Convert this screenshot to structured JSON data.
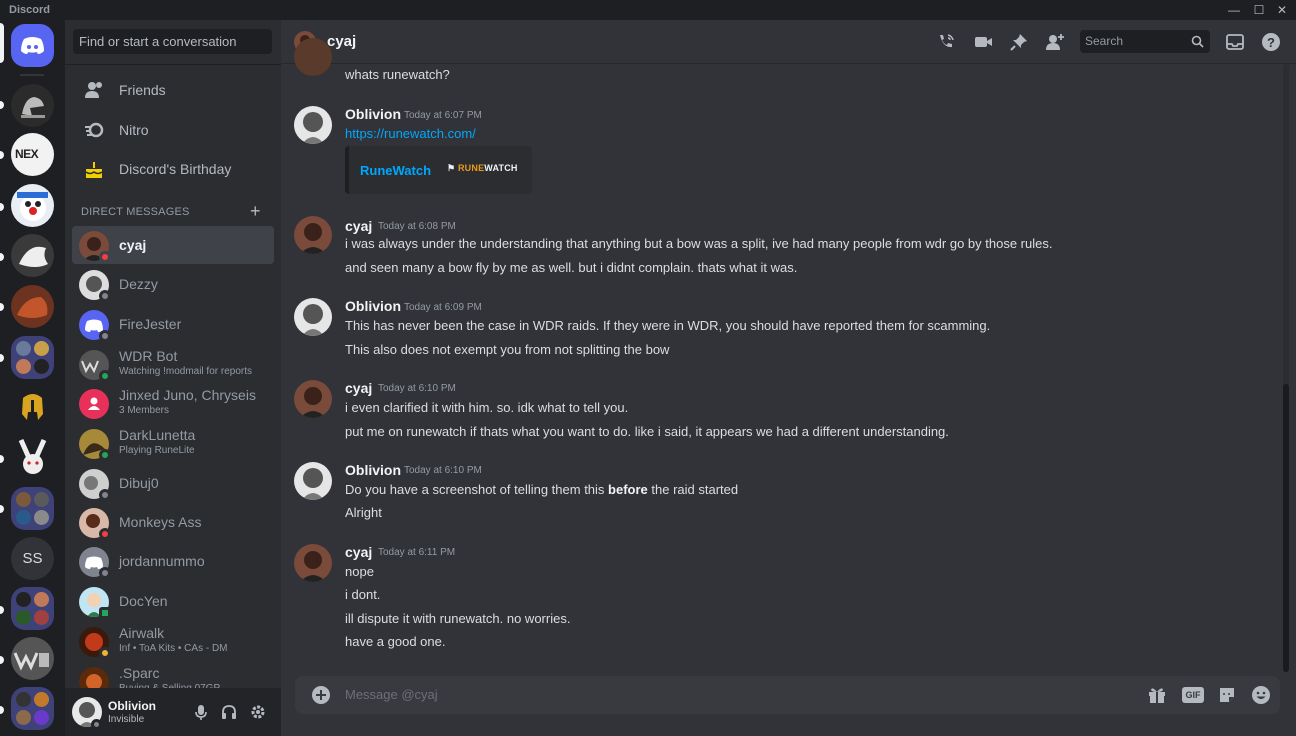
{
  "app": {
    "title": "Discord"
  },
  "sidebar": {
    "search_placeholder": "Find or start a conversation",
    "nav": [
      {
        "label": "Friends"
      },
      {
        "label": "Nitro"
      },
      {
        "label": "Discord's Birthday"
      }
    ],
    "dm_header": "DIRECT MESSAGES",
    "dms": [
      {
        "name": "cyaj",
        "sub": "",
        "status": "dnd",
        "active": true
      },
      {
        "name": "Dezzy",
        "sub": "",
        "status": "offline"
      },
      {
        "name": "FireJester",
        "sub": "",
        "status": "offline"
      },
      {
        "name": "WDR Bot",
        "sub": "Watching !modmail for reports",
        "status": "online"
      },
      {
        "name": "Jinxed Juno, Chryseis",
        "sub": "3 Members",
        "status": ""
      },
      {
        "name": "DarkLunetta",
        "sub": "Playing RuneLite",
        "status": "online"
      },
      {
        "name": "Dibuj0",
        "sub": "",
        "status": "offline"
      },
      {
        "name": "Monkeys Ass",
        "sub": "",
        "status": "dnd"
      },
      {
        "name": "jordannummo",
        "sub": "",
        "status": "offline"
      },
      {
        "name": "DocYen",
        "sub": "",
        "status": "mobile"
      },
      {
        "name": "Airwalk",
        "sub": "Inf • ToA Kits • CAs - DM",
        "status": "idle"
      },
      {
        "name": ".Sparc",
        "sub": "Buying & Selling 07GP",
        "status": ""
      }
    ]
  },
  "servers": {
    "ss_label": "SS",
    "nex_label": "NEX"
  },
  "user": {
    "name": "Oblivion",
    "status": "Invisible"
  },
  "channel": {
    "name": "cyaj",
    "search_placeholder": "Search"
  },
  "messages": {
    "m0": {
      "line1": "whats runewatch?"
    },
    "m1": {
      "author": "Oblivion",
      "time": "Today at 6:07 PM",
      "link": "https://runewatch.com/",
      "embed_title": "RuneWatch",
      "embed_logo_a": "RUNE",
      "embed_logo_b": "WATCH"
    },
    "m2": {
      "author": "cyaj",
      "time": "Today at 6:08 PM",
      "line1": "i was always under the understanding that anything but a bow was a split, ive had many people from wdr go by those rules.",
      "line2": "and seen many a bow fly by me as well. but i didnt complain. thats what it was."
    },
    "m3": {
      "author": "Oblivion",
      "time": "Today at 6:09 PM",
      "line1": "This has never been the case in WDR raids. If they were in WDR, you should have reported them for scamming.",
      "line2": "This also does not exempt you from not splitting the bow"
    },
    "m4": {
      "author": "cyaj",
      "time": "Today at 6:10 PM",
      "line1": "i even clarified it with him. so. idk what to tell you.",
      "line2": "put me on runewatch if thats what you want to do. like i said, it appears we had a different understanding."
    },
    "m5": {
      "author": "Oblivion",
      "time": "Today at 6:10 PM",
      "line1_a": "Do you have a screenshot of telling them this ",
      "line1_b": "before",
      "line1_c": " the raid started",
      "line2": "Alright"
    },
    "m6": {
      "author": "cyaj",
      "time": "Today at 6:11 PM",
      "line1": "nope",
      "line2": "i dont.",
      "line3": "ill dispute it with runewatch. no worries.",
      "line4": "have a good one."
    }
  },
  "composer": {
    "placeholder": "Message @cyaj",
    "gif_label": "GIF"
  },
  "colors": {
    "blurple": "#5865f2",
    "online": "#23a55a",
    "dnd": "#f23f43",
    "idle": "#f0b232",
    "offline": "#80848e",
    "link": "#00a8fc"
  }
}
